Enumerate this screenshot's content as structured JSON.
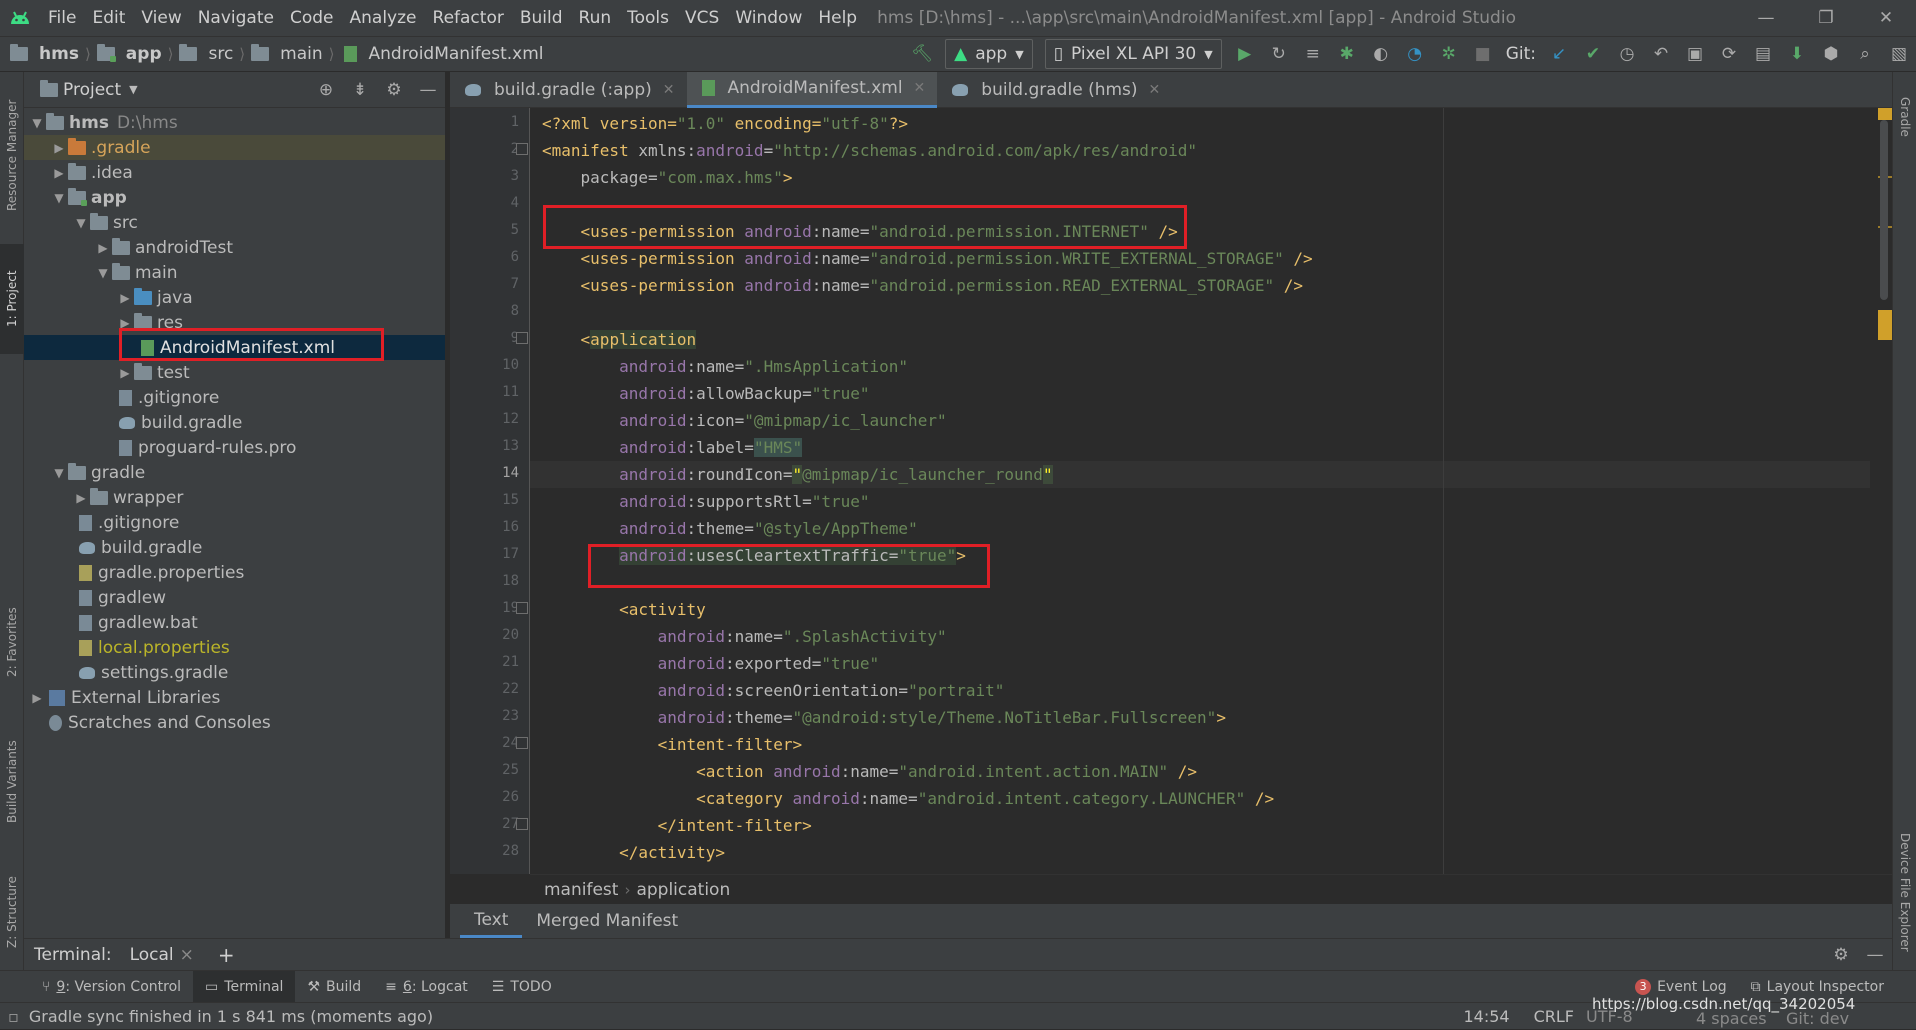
{
  "menubar": {
    "items": [
      "File",
      "Edit",
      "View",
      "Navigate",
      "Code",
      "Analyze",
      "Refactor",
      "Build",
      "Run",
      "Tools",
      "VCS",
      "Window",
      "Help"
    ],
    "window_title": "hms [D:\\hms] - ...\\app\\src\\main\\AndroidManifest.xml [app] - Android Studio",
    "minimize": "—",
    "restore": "❐",
    "close": "✕"
  },
  "navbar": {
    "breadcrumbs": [
      "hms",
      "app",
      "src",
      "main",
      "AndroidManifest.xml"
    ],
    "run_config": "app",
    "device": "Pixel XL API 30",
    "git_label": "Git:"
  },
  "left_stripe": {
    "resource_manager": "Resource Manager",
    "project": "1: Project",
    "favorites": "2: Favorites",
    "build_variants": "Build Variants",
    "structure": "Z: Structure"
  },
  "right_stripe": {
    "gradle": "Gradle",
    "device_file_explorer": "Device File Explorer"
  },
  "project_panel": {
    "title": "Project",
    "tree": [
      {
        "label": "hms",
        "path": "D:\\hms"
      },
      {
        "label": ".gradle"
      },
      {
        "label": ".idea"
      },
      {
        "label": "app"
      },
      {
        "label": "src"
      },
      {
        "label": "androidTest"
      },
      {
        "label": "main"
      },
      {
        "label": "java"
      },
      {
        "label": "res"
      },
      {
        "label": "AndroidManifest.xml"
      },
      {
        "label": "test"
      },
      {
        "label": ".gitignore"
      },
      {
        "label": "build.gradle"
      },
      {
        "label": "proguard-rules.pro"
      },
      {
        "label": "gradle"
      },
      {
        "label": "wrapper"
      },
      {
        "label": ".gitignore"
      },
      {
        "label": "build.gradle"
      },
      {
        "label": "gradle.properties"
      },
      {
        "label": "gradlew"
      },
      {
        "label": "gradlew.bat"
      },
      {
        "label": "local.properties"
      },
      {
        "label": "settings.gradle"
      },
      {
        "label": "External Libraries"
      },
      {
        "label": "Scratches and Consoles"
      }
    ]
  },
  "editor_tabs": [
    "build.gradle (:app)",
    "AndroidManifest.xml",
    "build.gradle (hms)"
  ],
  "code": {
    "line_numbers": [
      "1",
      "2",
      "3",
      "4",
      "5",
      "6",
      "7",
      "8",
      "9",
      "10",
      "11",
      "12",
      "13",
      "14",
      "15",
      "16",
      "17",
      "18",
      "19",
      "20",
      "21",
      "22",
      "23",
      "24",
      "25",
      "26",
      "27",
      "28"
    ],
    "l1": {
      "a": "<?xml version=",
      "b": "\"1.0\"",
      "c": " encoding=",
      "d": "\"utf-8\"",
      "e": "?>"
    },
    "l2": {
      "a": "<manifest ",
      "b": "xmlns:",
      "c": "android",
      "d": "=",
      "e": "\"http://schemas.android.com/apk/res/android\""
    },
    "l3": {
      "a": "    package=",
      "b": "\"com.max.hms\"",
      "c": ">"
    },
    "l5": {
      "a": "    <uses-permission ",
      "b": "android",
      "c": ":name=",
      "d": "\"android.permission.INTERNET\"",
      "e": " />"
    },
    "l6": {
      "a": "    <uses-permission ",
      "b": "android",
      "c": ":name=",
      "d": "\"android.permission.WRITE_EXTERNAL_STORAGE\"",
      "e": " />"
    },
    "l7": {
      "a": "    <uses-permission ",
      "b": "android",
      "c": ":name=",
      "d": "\"android.permission.READ_EXTERNAL_STORAGE\"",
      "e": " />"
    },
    "l9": {
      "a": "    <",
      "b": "application"
    },
    "l10": {
      "a": "        ",
      "b": "android",
      "c": ":name=",
      "d": "\".HmsApplication\""
    },
    "l11": {
      "a": "        ",
      "b": "android",
      "c": ":allowBackup=",
      "d": "\"true\""
    },
    "l12": {
      "a": "        ",
      "b": "android",
      "c": ":icon=",
      "d": "\"@mipmap/ic_launcher\""
    },
    "l13": {
      "a": "        ",
      "b": "android",
      "c": ":label=",
      "d": "\"HMS\""
    },
    "l14": {
      "a": "        ",
      "b": "android",
      "c": ":roundIcon=",
      "d": "\"",
      "e": "@mipmap/ic_launcher_round",
      "f": "\""
    },
    "l15": {
      "a": "        ",
      "b": "android",
      "c": ":supportsRtl=",
      "d": "\"true\""
    },
    "l16": {
      "a": "        ",
      "b": "android",
      "c": ":theme=",
      "d": "\"@style/AppTheme\""
    },
    "l17": {
      "a": "        ",
      "b": "android",
      "c": ":usesCleartextTraffic=",
      "d": "\"true\"",
      "e": ">"
    },
    "l19": {
      "a": "        <activity"
    },
    "l20": {
      "a": "            ",
      "b": "android",
      "c": ":name=",
      "d": "\".SplashActivity\""
    },
    "l21": {
      "a": "            ",
      "b": "android",
      "c": ":exported=",
      "d": "\"true\""
    },
    "l22": {
      "a": "            ",
      "b": "android",
      "c": ":screenOrientation=",
      "d": "\"portrait\""
    },
    "l23": {
      "a": "            ",
      "b": "android",
      "c": ":theme=",
      "d": "\"@android:style/Theme.NoTitleBar.Fullscreen\"",
      "e": ">"
    },
    "l24": {
      "a": "            <intent-filter>"
    },
    "l25": {
      "a": "                <action ",
      "b": "android",
      "c": ":name=",
      "d": "\"android.intent.action.MAIN\"",
      "e": " />"
    },
    "l26": {
      "a": "                <category ",
      "b": "android",
      "c": ":name=",
      "d": "\"android.intent.category.LAUNCHER\"",
      "e": " />"
    },
    "l27": {
      "a": "            </intent-filter>"
    },
    "l28": {
      "a": "        </activity>"
    }
  },
  "editor_breadcrumb": [
    "manifest",
    "application"
  ],
  "editor_bottom_tabs": [
    "Text",
    "Merged Manifest"
  ],
  "terminal": {
    "label": "Terminal:",
    "tab": "Local",
    "tab_close": "×",
    "add": "+"
  },
  "bottom_tools": [
    {
      "mnemonic": "9",
      "label": ": Version Control"
    },
    {
      "label": "Terminal"
    },
    {
      "label": "Build"
    },
    {
      "mnemonic": "6",
      "label": ": Logcat"
    },
    {
      "label": "TODO"
    }
  ],
  "event_log": {
    "count": "3",
    "label": "Event Log"
  },
  "layout_inspector": "Layout Inspector",
  "status": {
    "message": "Gradle sync finished in 1 s 841 ms (moments ago)",
    "position": "14:54",
    "line_sep": "CRLF",
    "encoding": "UTF-8",
    "indent": "4 spaces",
    "git_branch": "Git: dev",
    "watermark": "https://blog.csdn.net/qq_34202054"
  },
  "colors": {
    "highlight_box": "#e01f26",
    "accent": "#4a88c7"
  }
}
